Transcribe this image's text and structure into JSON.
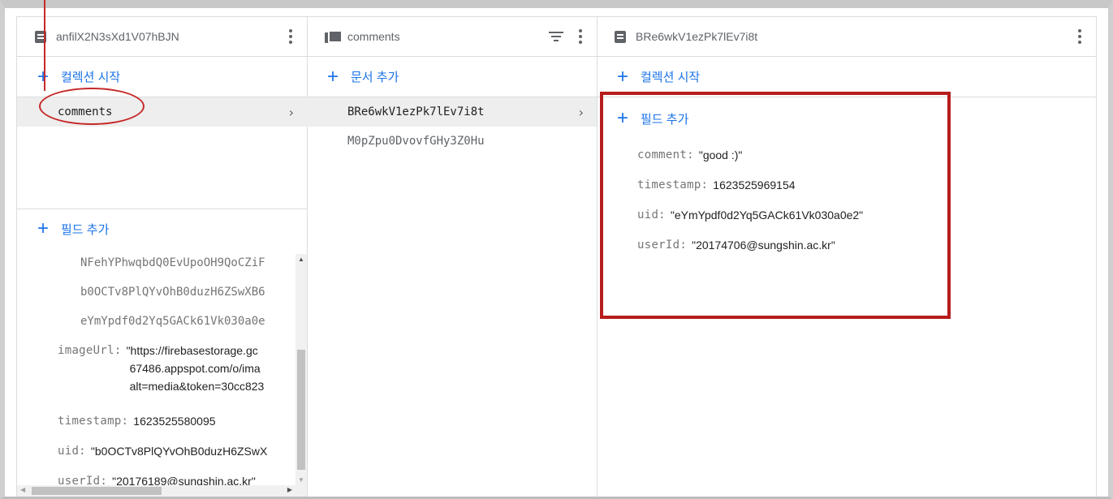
{
  "col1": {
    "title": "anfilX2N3sXd1V07hBJN",
    "start_collection": "컬렉션 시작",
    "collections": [
      {
        "name": "comments"
      }
    ],
    "add_field": "필드 추가",
    "array_items": [
      "NFehYPhwqbdQ0EvUpoOH9QoCZiF",
      "b0OCTv8PlQYvOhB0duzH6ZSwXB6",
      "eYmYpdf0d2Yq5GACk61Vk030a0e"
    ],
    "fields": {
      "imageUrl_key": "imageUrl:",
      "imageUrl_line1": "\"https://firebasestorage.gc",
      "imageUrl_line2": "67486.appspot.com/o/ima",
      "imageUrl_line3": "alt=media&token=30cc823",
      "timestamp_key": "timestamp:",
      "timestamp_val": "1623525580095",
      "uid_key": "uid:",
      "uid_val": "\"b0OCTv8PlQYvOhB0duzH6ZSwX",
      "userId_key": "userId:",
      "userId_val": "\"20176189@sungshin.ac.kr\""
    }
  },
  "col2": {
    "title": "comments",
    "add_document": "문서 추가",
    "documents": [
      {
        "id": "BRe6wkV1ezPk7lEv7i8t"
      },
      {
        "id": "M0pZpu0DvovfGHy3Z0Hu"
      }
    ]
  },
  "col3": {
    "title": "BRe6wkV1ezPk7lEv7i8t",
    "start_collection": "컬렉션 시작",
    "add_field": "필드 추가",
    "fields": [
      {
        "key": "comment:",
        "value": "\"good :)\""
      },
      {
        "key": "timestamp:",
        "value": "1623525969154"
      },
      {
        "key": "uid:",
        "value": "\"eYmYpdf0d2Yq5GACk61Vk030a0e2\""
      },
      {
        "key": "userId:",
        "value": "\"20174706@sungshin.ac.kr\""
      }
    ]
  },
  "colors": {
    "accent": "#1a73e8",
    "annotation": "#c62828"
  }
}
